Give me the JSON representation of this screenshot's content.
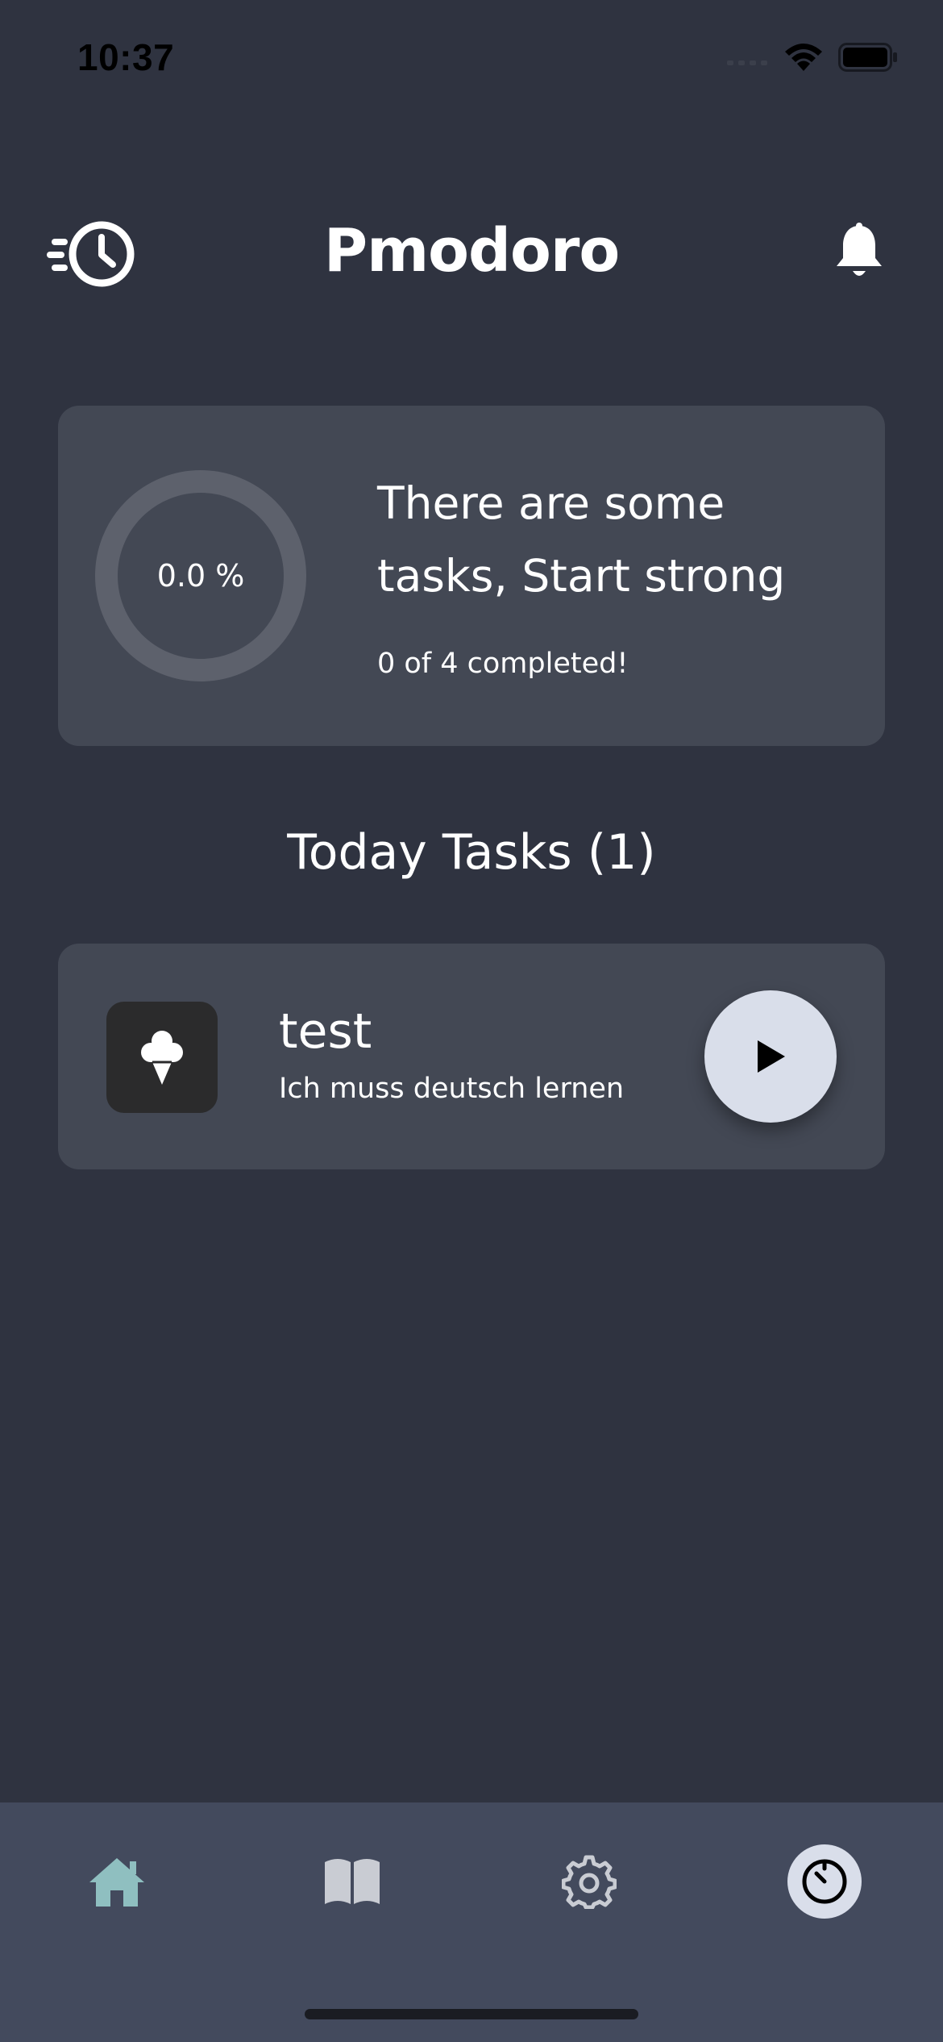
{
  "status_bar": {
    "time": "10:37"
  },
  "header": {
    "title": "Pmodoro",
    "left_icon": "history-clock-icon",
    "right_icon": "bell-icon"
  },
  "summary": {
    "progress_label": "0.0 %",
    "progress_fraction": 0.0,
    "heading": "There are some tasks, Start strong",
    "count_text": "0 of 4 completed!"
  },
  "tasks_section": {
    "title": "Today Tasks (1)"
  },
  "tasks": [
    {
      "title": "test",
      "description": "Ich muss deutsch lernen",
      "icon": "ice-cream-icon",
      "action_icon": "play-icon"
    }
  ],
  "bottom_nav": {
    "items": [
      {
        "icon": "home-icon",
        "active": true
      },
      {
        "icon": "book-icon",
        "active": false
      },
      {
        "icon": "gear-icon",
        "active": false
      },
      {
        "icon": "timer-icon",
        "active": false
      }
    ]
  },
  "colors": {
    "background": "#2f3340",
    "card": "#434854",
    "nav_background": "#434a5d",
    "accent_home": "#8fbfc0",
    "button_light": "#d9deea"
  }
}
